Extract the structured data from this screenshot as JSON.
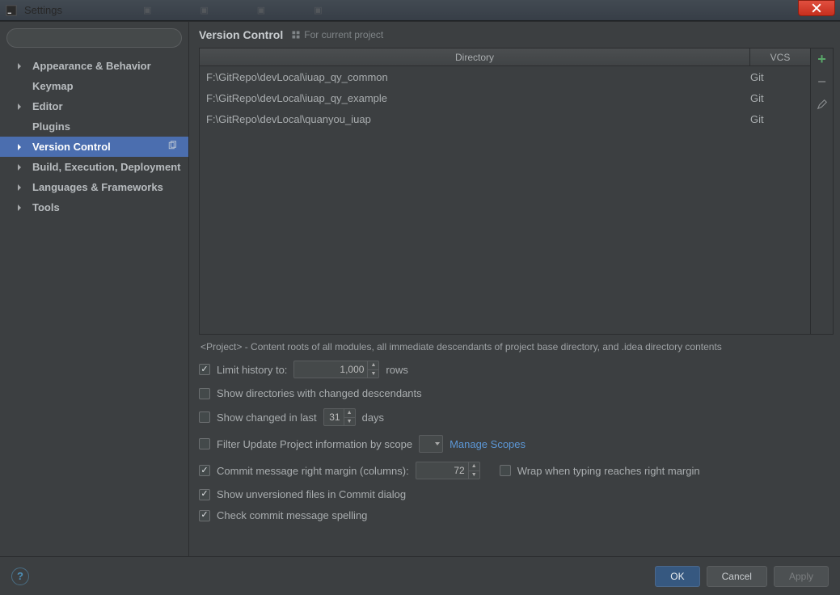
{
  "window": {
    "title": "Settings"
  },
  "sidebar": {
    "items": [
      {
        "label": "Appearance & Behavior",
        "bold": true,
        "arrow": true
      },
      {
        "label": "Keymap",
        "bold": true,
        "child": true
      },
      {
        "label": "Editor",
        "bold": true,
        "arrow": true
      },
      {
        "label": "Plugins",
        "bold": true,
        "child": true
      },
      {
        "label": "Version Control",
        "bold": true,
        "arrow": true,
        "selected": true,
        "copy": true
      },
      {
        "label": "Build, Execution, Deployment",
        "bold": true,
        "arrow": true
      },
      {
        "label": "Languages & Frameworks",
        "bold": true,
        "arrow": true
      },
      {
        "label": "Tools",
        "bold": true,
        "arrow": true
      }
    ]
  },
  "main": {
    "heading": "Version Control",
    "subheading": "For current project",
    "table": {
      "headers": {
        "dir": "Directory",
        "vcs": "VCS"
      },
      "rows": [
        {
          "dir": "F:\\GitRepo\\devLocal\\iuap_qy_common",
          "vcs": "Git"
        },
        {
          "dir": "F:\\GitRepo\\devLocal\\iuap_qy_example",
          "vcs": "Git"
        },
        {
          "dir": "F:\\GitRepo\\devLocal\\quanyou_iuap",
          "vcs": "Git"
        }
      ]
    },
    "hint": "<Project> - Content roots of all modules, all immediate descendants of project base directory, and .idea directory contents",
    "options": {
      "limit_history_label": "Limit history to:",
      "limit_history_value": "1,000",
      "limit_history_unit": "rows",
      "show_dirs_label": "Show directories with changed descendants",
      "show_changed_label_a": "Show changed in last",
      "show_changed_value": "31",
      "show_changed_label_b": "days",
      "filter_scope_label": "Filter Update Project information by scope",
      "manage_scopes": "Manage Scopes",
      "commit_margin_label": "Commit message right margin (columns):",
      "commit_margin_value": "72",
      "wrap_label": "Wrap when typing reaches right margin",
      "show_unversioned_label": "Show unversioned files in Commit dialog",
      "check_spelling_label": "Check commit message spelling"
    }
  },
  "footer": {
    "ok": "OK",
    "cancel": "Cancel",
    "apply": "Apply"
  }
}
